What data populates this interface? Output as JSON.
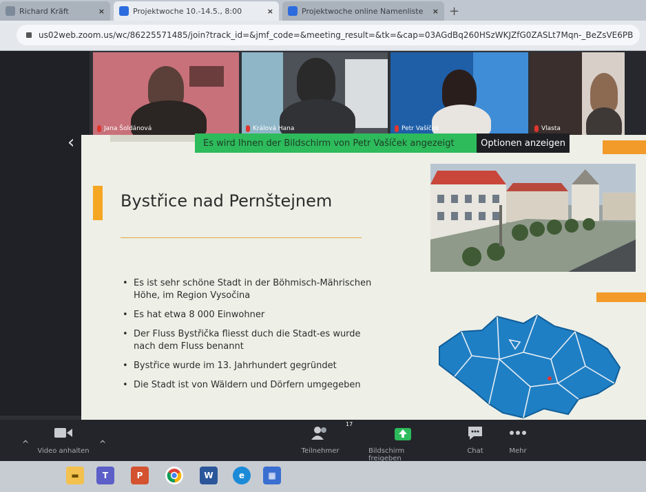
{
  "browser": {
    "tabs": [
      {
        "label": "Richard Kräft",
        "active": false
      },
      {
        "label": "Projektwoche 10.-14.5., 8:00",
        "active": true
      },
      {
        "label": "Projektwoche online Namenliste",
        "active": false
      }
    ],
    "new_tab_label": "+",
    "url": "us02web.zoom.us/wc/86225571485/join?track_id=&jmf_code=&meeting_result=&tk=&cap=03AGdBq260HSzWKJZfG0ZASLt7Mqn-_BeZsVE6PB"
  },
  "participants": [
    {
      "name": "Jana Šoldánová"
    },
    {
      "name": "Králová Hana"
    },
    {
      "name": "Petr Vašíček"
    },
    {
      "name": "Vlasta"
    },
    {
      "name": ""
    }
  ],
  "share_banner": {
    "text": "Es wird Ihnen der Bildschirm von Petr Vašíček angezeigt",
    "options_label": "Optionen anzeigen"
  },
  "slide": {
    "title": "Bystřice nad Pernštejnem",
    "bullets": [
      "Es ist sehr schöne Stadt in der Böhmisch-Mährischen Höhe, im Region Vysočina",
      "Es hat etwa 8 000 Einwohner",
      "Der Fluss Bystřička fliesst duch die Stadt-es wurde nach dem Fluss benannt",
      "Bystřice wurde im 13. Jahrhundert gegründet",
      "Die Stadt ist von Wäldern und Dörfern umgegeben"
    ]
  },
  "toolbar": {
    "video_label": "Video anhalten",
    "participants_label": "Teilnehmer",
    "participants_count": "17",
    "share_label": "Bildschirm freigeben",
    "chat_label": "Chat",
    "more_label": "Mehr"
  },
  "taskbar": {
    "apps": [
      "file-explorer",
      "teams",
      "powerpoint",
      "chrome",
      "word",
      "edge",
      "photos"
    ]
  },
  "colors": {
    "share_green": "#2dbb5c",
    "accent_orange": "#f29a2a",
    "map_blue": "#1f7fc4",
    "toolbar_bg": "#23252a"
  }
}
